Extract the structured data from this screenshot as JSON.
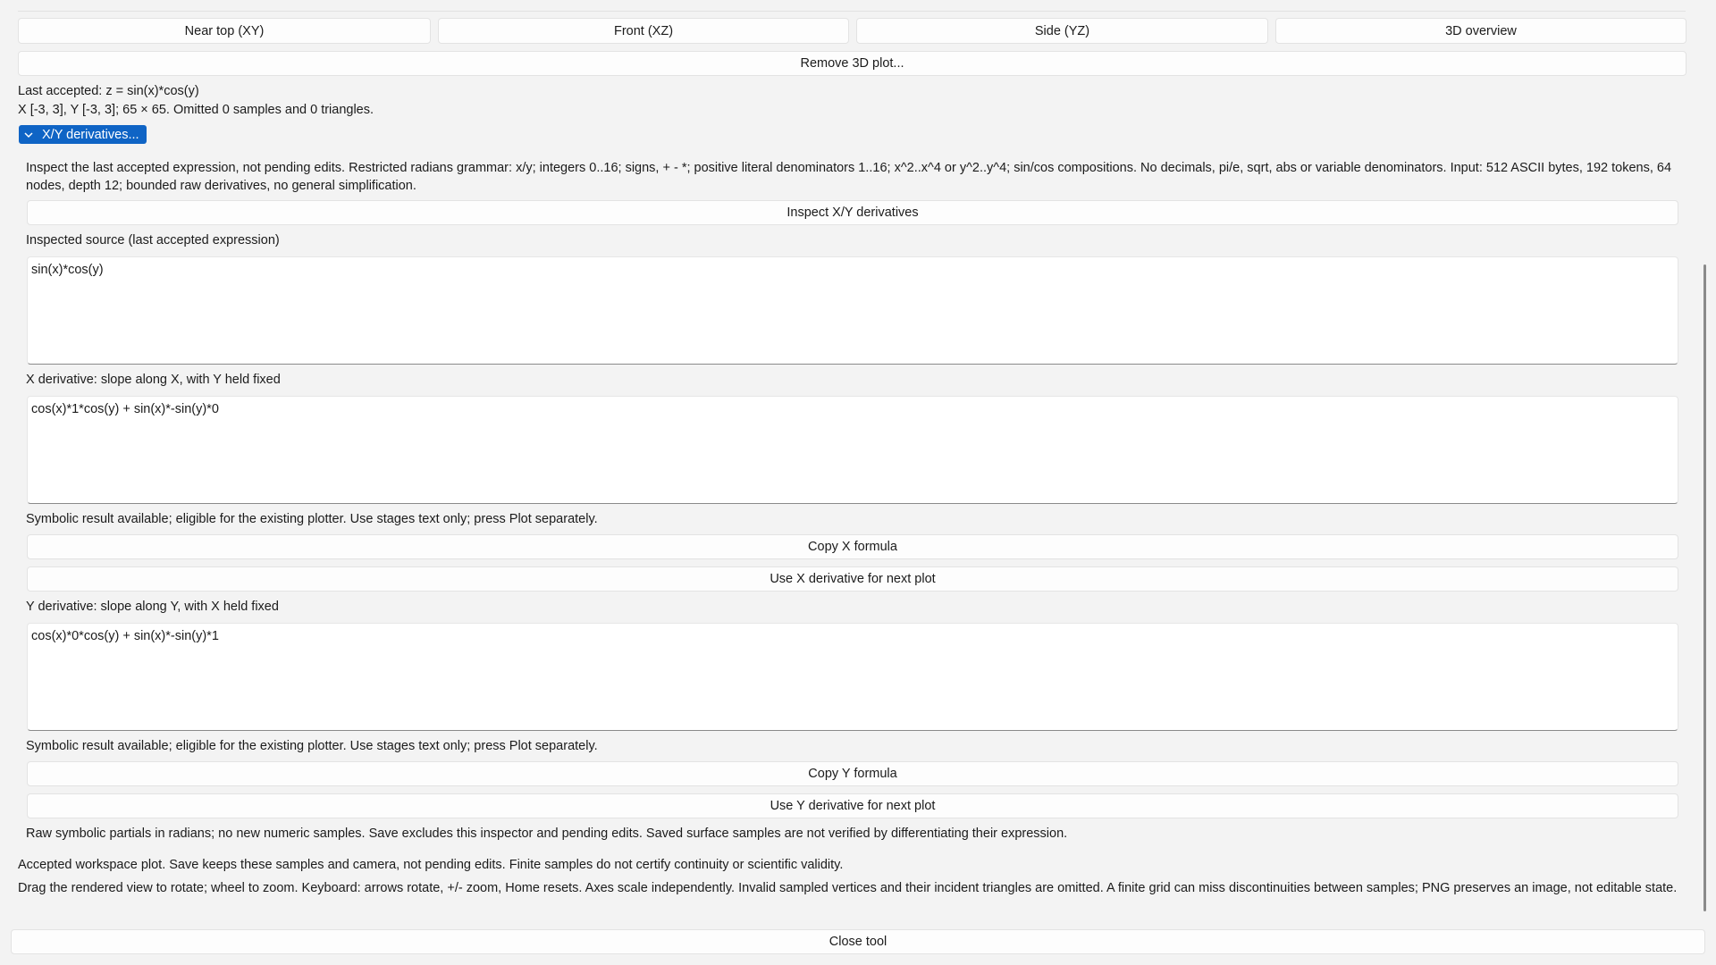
{
  "view_buttons": [
    "Near top (XY)",
    "Front (XZ)",
    "Side (YZ)",
    "3D overview"
  ],
  "remove_label": "Remove 3D plot...",
  "status": {
    "last_accepted": "Last accepted: z = sin(x)*cos(y)",
    "range": "X [-3, 3], Y [-3, 3]; 65 × 65. Omitted 0 samples and 0 triangles."
  },
  "derivatives_toggle": "X/Y derivatives...",
  "inspector": {
    "description": "Inspect the last accepted expression, not pending edits. Restricted radians grammar: x/y; integers 0..16; signs, + - *; positive literal denominators 1..16; x^2..x^4 or y^2..y^4; sin/cos compositions. No decimals, pi/e, sqrt, abs or variable denominators. Input: 512 ASCII bytes, 192 tokens, 64 nodes, depth 12; bounded raw derivatives, no general simplification.",
    "inspect_button": "Inspect X/Y derivatives",
    "source_label": "Inspected source (last accepted expression)",
    "source_value": "sin(x)*cos(y)",
    "x_label": "X derivative: slope along X, with Y held fixed",
    "x_value": "cos(x)*1*cos(y) + sin(x)*-sin(y)*0",
    "x_status": "Symbolic result available; eligible for the existing plotter. Use stages text only; press Plot separately.",
    "copy_x": "Copy X formula",
    "use_x": "Use X derivative for next plot",
    "y_label": "Y derivative: slope along Y, with X held fixed",
    "y_value": "cos(x)*0*cos(y) + sin(x)*-sin(y)*1",
    "y_status": "Symbolic result available; eligible for the existing plotter. Use stages text only; press Plot separately.",
    "copy_y": "Copy Y formula",
    "use_y": "Use Y derivative for next plot",
    "footnote": "Raw symbolic partials in radians; no new numeric samples. Save excludes this inspector and pending edits. Saved surface samples are not verified by differentiating their expression."
  },
  "footer": {
    "accepted_note": "Accepted workspace plot. Save keeps these samples and camera, not pending edits. Finite samples do not certify continuity or scientific validity.",
    "help": "Drag the rendered view to rotate; wheel to zoom. Keyboard: arrows rotate, +/- zoom, Home resets. Axes scale independently. Invalid sampled vertices and their incident triangles are omitted. A finite grid can miss discontinuities between samples; PNG preserves an image, not editable state.",
    "close": "Close tool"
  },
  "colors": {
    "accent": "#0f64c5",
    "background": "#f3f3f3"
  }
}
